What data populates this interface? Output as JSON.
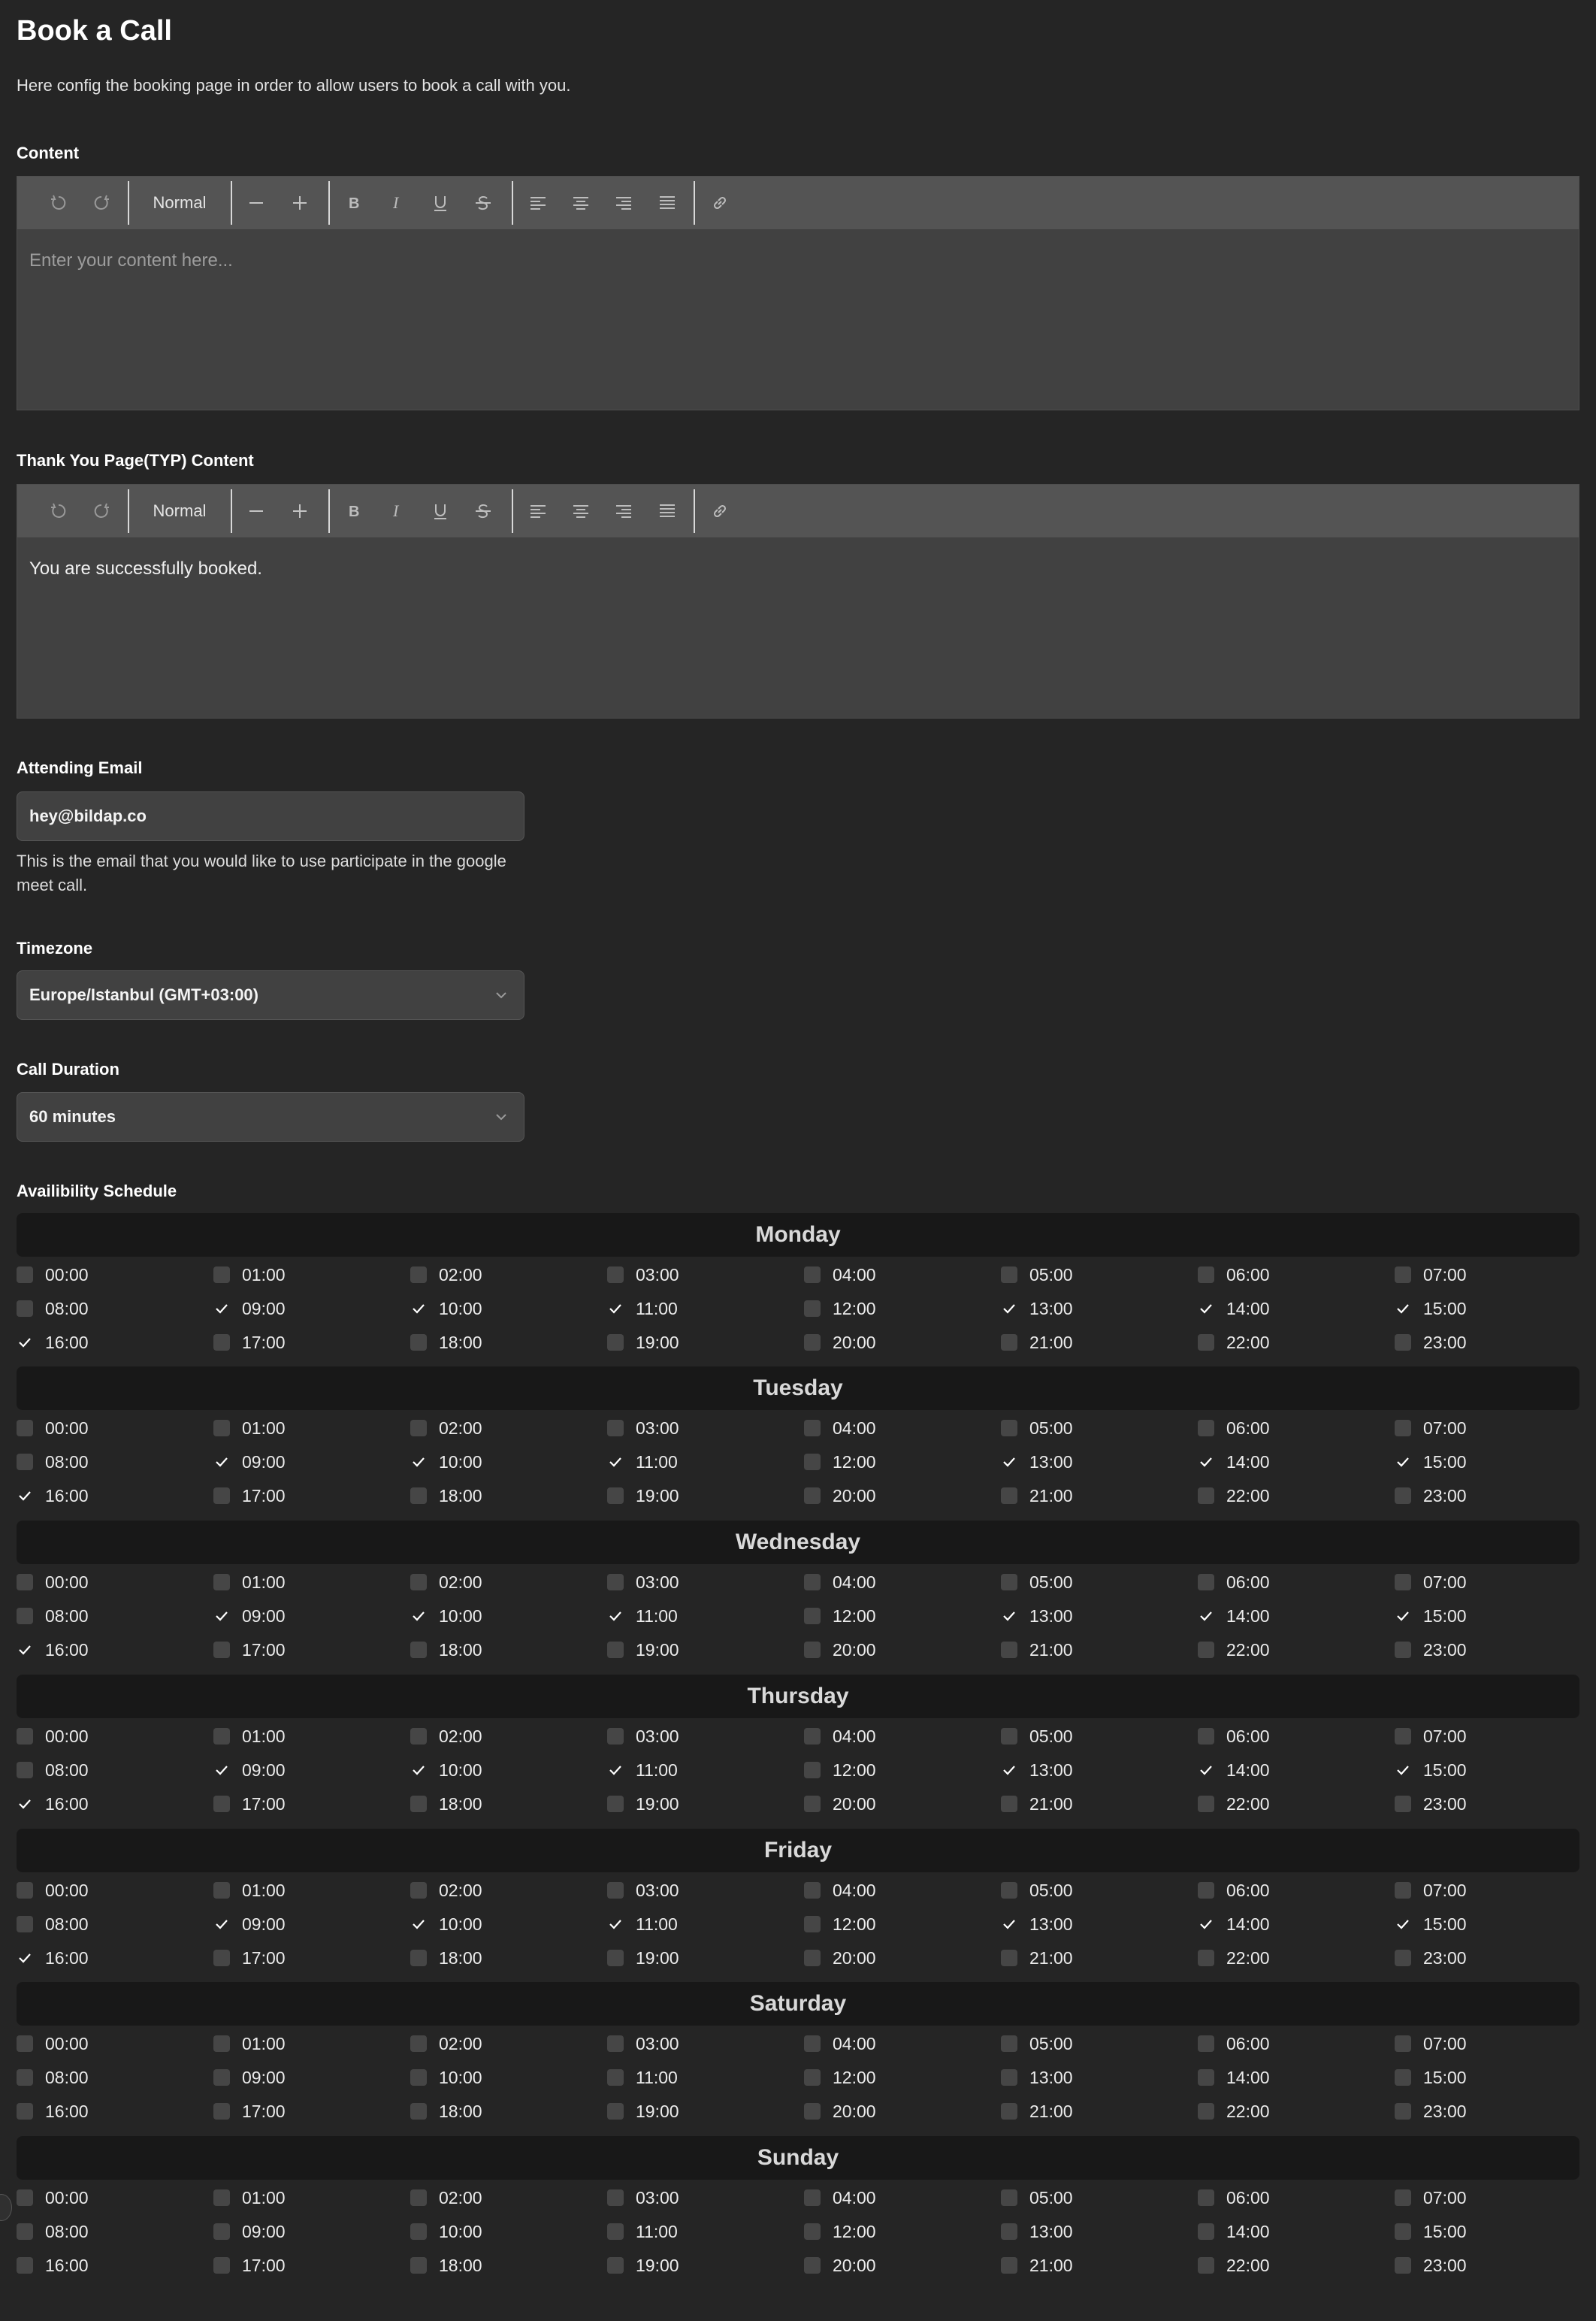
{
  "page": {
    "title": "Book a Call",
    "description": "Here config the booking page in order to allow users to book a call with you."
  },
  "content_editor": {
    "label": "Content",
    "format": "Normal",
    "placeholder": "Enter your content here...",
    "value": ""
  },
  "typ_editor": {
    "label": "Thank You Page(TYP) Content",
    "format": "Normal",
    "placeholder": "",
    "value": "You are successfully booked."
  },
  "toolbar_icons": [
    "undo-icon",
    "redo-icon",
    "format-select",
    "decrease-icon",
    "increase-icon",
    "bold-icon",
    "italic-icon",
    "underline-icon",
    "strikethrough-icon",
    "align-left-icon",
    "align-center-icon",
    "align-right-icon",
    "align-justify-icon",
    "link-icon"
  ],
  "attending_email": {
    "label": "Attending Email",
    "value": "hey@bildap.co",
    "help": "This is the email that you would like to use participate in the google meet call."
  },
  "timezone": {
    "label": "Timezone",
    "value": "Europe/Istanbul (GMT+03:00)"
  },
  "call_duration": {
    "label": "Call Duration",
    "value": "60 minutes"
  },
  "schedule": {
    "label": "Availibility Schedule",
    "hours": [
      "00:00",
      "01:00",
      "02:00",
      "03:00",
      "04:00",
      "05:00",
      "06:00",
      "07:00",
      "08:00",
      "09:00",
      "10:00",
      "11:00",
      "12:00",
      "13:00",
      "14:00",
      "15:00",
      "16:00",
      "17:00",
      "18:00",
      "19:00",
      "20:00",
      "21:00",
      "22:00",
      "23:00"
    ],
    "days": [
      {
        "name": "Monday",
        "checked": [
          "09:00",
          "10:00",
          "11:00",
          "13:00",
          "14:00",
          "15:00",
          "16:00"
        ]
      },
      {
        "name": "Tuesday",
        "checked": [
          "09:00",
          "10:00",
          "11:00",
          "13:00",
          "14:00",
          "15:00",
          "16:00"
        ]
      },
      {
        "name": "Wednesday",
        "checked": [
          "09:00",
          "10:00",
          "11:00",
          "13:00",
          "14:00",
          "15:00",
          "16:00"
        ]
      },
      {
        "name": "Thursday",
        "checked": [
          "09:00",
          "10:00",
          "11:00",
          "13:00",
          "14:00",
          "15:00",
          "16:00"
        ]
      },
      {
        "name": "Friday",
        "checked": [
          "09:00",
          "10:00",
          "11:00",
          "13:00",
          "14:00",
          "15:00",
          "16:00"
        ]
      },
      {
        "name": "Saturday",
        "checked": []
      },
      {
        "name": "Sunday",
        "checked": []
      }
    ]
  },
  "colors": {
    "background": "#252525",
    "editor_bg": "#414141",
    "toolbar_bg": "#545454",
    "day_header_bg": "#181818",
    "checkbox_bg": "#464646"
  }
}
